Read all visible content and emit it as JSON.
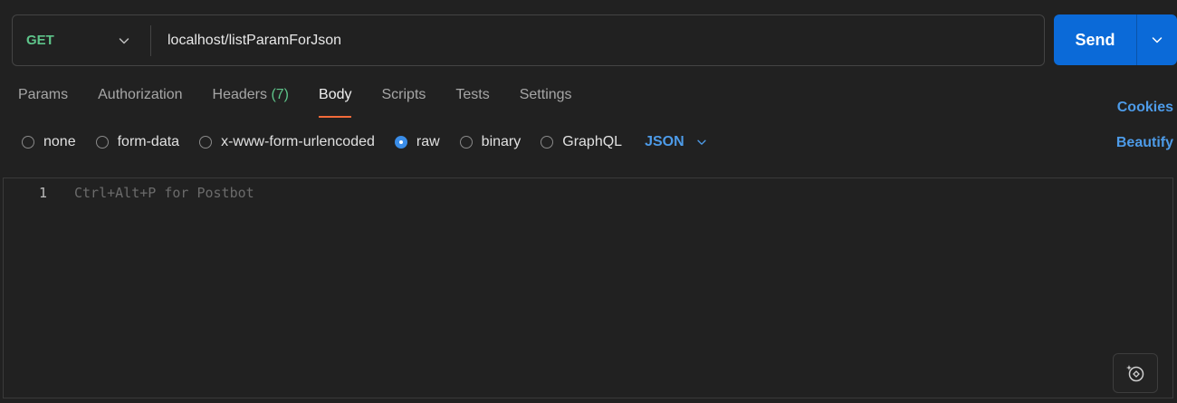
{
  "request": {
    "method": "GET",
    "url": "localhost/listParamForJson"
  },
  "send": {
    "label": "Send"
  },
  "tabs": [
    {
      "label": "Params",
      "count": ""
    },
    {
      "label": "Authorization",
      "count": ""
    },
    {
      "label": "Headers",
      "count": "(7)"
    },
    {
      "label": "Body",
      "count": ""
    },
    {
      "label": "Scripts",
      "count": ""
    },
    {
      "label": "Tests",
      "count": ""
    },
    {
      "label": "Settings",
      "count": ""
    }
  ],
  "active_tab": "Body",
  "links": {
    "cookies": "Cookies",
    "beautify": "Beautify"
  },
  "body_types": [
    {
      "label": "none",
      "checked": false
    },
    {
      "label": "form-data",
      "checked": false
    },
    {
      "label": "x-www-form-urlencoded",
      "checked": false
    },
    {
      "label": "raw",
      "checked": true
    },
    {
      "label": "binary",
      "checked": false
    },
    {
      "label": "GraphQL",
      "checked": false
    }
  ],
  "raw_language": "JSON",
  "editor": {
    "line_number": "1",
    "placeholder": "Ctrl+Alt+P for Postbot"
  },
  "colors": {
    "method_get": "#5ec48a",
    "accent_blue": "#0b6ad8",
    "link_blue": "#4d9be8",
    "active_tab_underline": "#f26b3a",
    "background": "#212121"
  },
  "icons": {
    "method_dropdown": "chevron-down-icon",
    "send_dropdown": "chevron-down-icon",
    "language_dropdown": "chevron-down-icon",
    "postbot": "postbot-sparkle-icon"
  }
}
